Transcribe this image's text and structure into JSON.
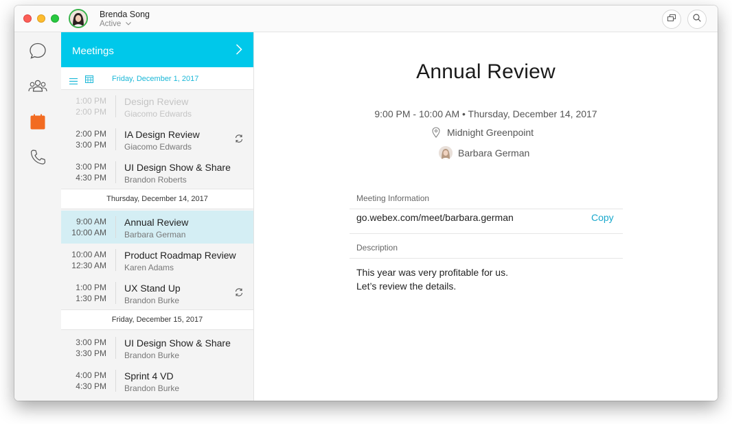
{
  "titlebar": {
    "user_name": "Brenda Song",
    "status": "Active"
  },
  "rail": {
    "items": [
      "chat-icon",
      "people-icon",
      "calendar-icon",
      "phone-icon"
    ],
    "active_color": "#f26b21"
  },
  "meetings": {
    "header": "Meetings",
    "header_color": "#00c8ea",
    "current_date": "Friday, December 1, 2017",
    "groups": [
      {
        "items": [
          {
            "start": "1:00 PM",
            "end": "2:00 PM",
            "title": "Design Review",
            "person": "Giacomo Edwards"
          },
          {
            "start": "2:00 PM",
            "end": "3:00 PM",
            "title": "IA Design Review",
            "person": "Giacomo Edwards"
          },
          {
            "start": "3:00 PM",
            "end": "4:30 PM",
            "title": "UI Design Show & Share",
            "person": "Brandon Roberts"
          }
        ]
      },
      {
        "date": "Thursday, December 14, 2017",
        "items": [
          {
            "start": "9:00 AM",
            "end": "10:00 AM",
            "title": "Annual Review",
            "person": "Barbara German"
          },
          {
            "start": "10:00 AM",
            "end": "12:30 AM",
            "title": "Product Roadmap Review",
            "person": "Karen Adams"
          },
          {
            "start": "1:00 PM",
            "end": "1:30 PM",
            "title": "UX Stand Up",
            "person": "Brandon Burke"
          }
        ]
      },
      {
        "date": "Friday, December 15, 2017",
        "items": [
          {
            "start": "3:00 PM",
            "end": "3:30 PM",
            "title": "UI Design Show & Share",
            "person": "Brandon Burke"
          },
          {
            "start": "4:00 PM",
            "end": "4:30 PM",
            "title": "Sprint 4 VD",
            "person": "Brandon Burke"
          }
        ]
      }
    ]
  },
  "detail": {
    "title": "Annual Review",
    "when": "9:00 PM - 10:00 AM • Thursday, December 14, 2017",
    "location": "Midnight Greenpoint",
    "host": "Barbara German",
    "meeting_info_label": "Meeting Information",
    "link": "go.webex.com/meet/barbara.german",
    "copy_label": "Copy",
    "description_label": "Description",
    "description_lines": [
      "This year was very profitable for us.",
      "Let’s review the details."
    ]
  }
}
